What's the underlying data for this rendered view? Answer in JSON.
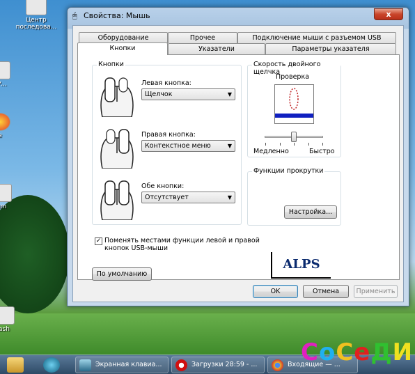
{
  "desktop": {
    "icons": [
      {
        "label": "Центр\nпоследова...",
        "name": "desktop-icon-center"
      },
      {
        "label": "..Р...",
        "name": "desktop-icon-2"
      },
      {
        "label": "e",
        "name": "desktop-icon-chrome"
      },
      {
        "label": "um",
        "name": "desktop-icon-3"
      },
      {
        "label": "ash",
        "name": "desktop-icon-flash"
      }
    ]
  },
  "window": {
    "title": "Свойства: Мышь",
    "close_label": "x",
    "tabs_row1": [
      "Оборудование",
      "Прочее",
      "Подключение мыши с разъемом USB"
    ],
    "tabs_row2": [
      "Кнопки",
      "Указатели",
      "Параметры указателя"
    ],
    "buttons_group": {
      "title": "Кнопки",
      "left_label": "Левая кнопка:",
      "left_value": "Щелчок",
      "right_label": "Правая кнопка:",
      "right_value": "Контекстное меню",
      "both_label": "Обе кнопки:",
      "both_value": "Отсутствует"
    },
    "double_click": {
      "title": "Скорость двойного щелчка",
      "test_label": "Проверка",
      "slow_label": "Медленно",
      "fast_label": "Быстро",
      "speed": 0.52
    },
    "scroll": {
      "title": "Функции прокрутки",
      "settings_button": "Настройка..."
    },
    "swap_checkbox": {
      "checked": true,
      "label": "Поменять местами функции левой и правой кнопок USB-мыши"
    },
    "default_button": "По умолчанию",
    "logo": "ALPS",
    "ok": "OK",
    "cancel": "Отмена",
    "apply": "Применить"
  },
  "taskbar": {
    "tasks": [
      {
        "label": "Экранная клавиа...",
        "name": "task-onscreen-keyboard"
      },
      {
        "label": "Загрузки 28:59 - ...",
        "name": "task-opera-downloads"
      },
      {
        "label": "Входящие — ...",
        "name": "task-chrome-inbox"
      }
    ]
  },
  "watermark": "СоСеДИ"
}
